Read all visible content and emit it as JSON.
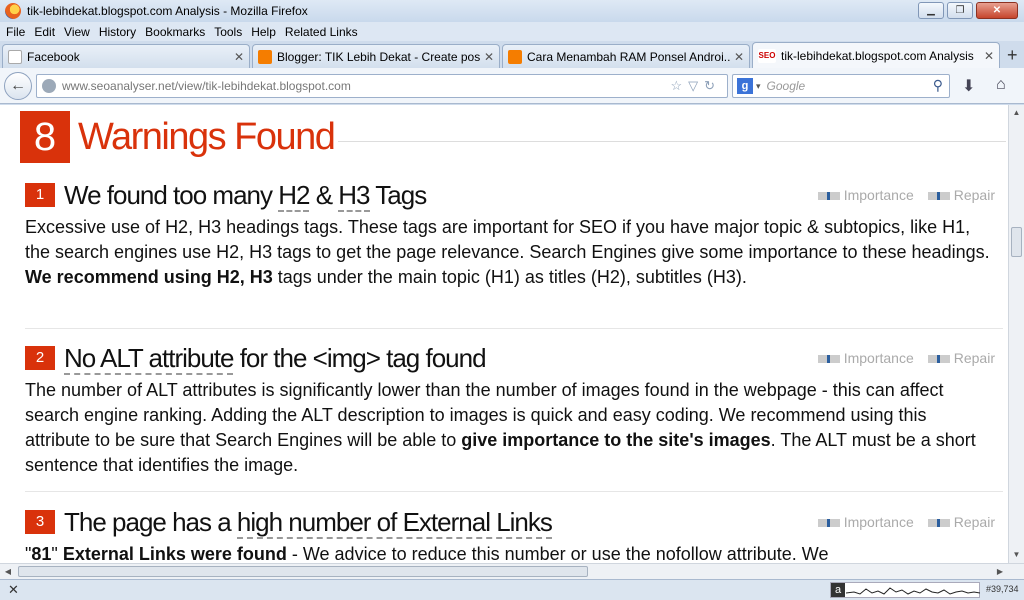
{
  "window": {
    "title": "tik-lebihdekat.blogspot.com Analysis - Mozilla Firefox"
  },
  "menu": [
    "File",
    "Edit",
    "View",
    "History",
    "Bookmarks",
    "Tools",
    "Help",
    "Related Links"
  ],
  "tabs": [
    {
      "label": "Facebook"
    },
    {
      "label": "Blogger: TIK Lebih Dekat - Create post"
    },
    {
      "label": "Cara Menambah RAM Ponsel Androi..."
    },
    {
      "label": "tik-lebihdekat.blogspot.com Analysis"
    }
  ],
  "nav": {
    "url_host": "www.seoanalyser.net",
    "url_path": "/view/tik-lebihdekat.blogspot.com",
    "search_engine": "g",
    "search_placeholder": "Google"
  },
  "warnings": {
    "count": "8",
    "title": "Warnings Found",
    "importance_label": "Importance",
    "repair_label": "Repair",
    "items": [
      {
        "num": "1",
        "title_pre": "We found too many ",
        "title_h2": "H2",
        "title_amp": " & ",
        "title_h3": "H3",
        "title_post": " Tags",
        "body": "Excessive use of H2, H3 headings tags. These tags are important for SEO if you have major topic & subtopics, like H1, the search engines use H2, H3 tags to get the page relevance. Search Engines give some importance to these headings. ",
        "body_bold": "We recommend using H2, H3",
        "body_tail": " tags under the main topic (H1) as titles (H2), subtitles (H3)."
      },
      {
        "num": "2",
        "title_link": "No ALT attribute",
        "title_post": " for the <img> tag found",
        "body": "The number of ALT attributes is significantly lower than the number of images found in the webpage - this can affect search engine ranking. Adding the ALT description to images is quick and easy coding. We recommend using this attribute to be sure that Search Engines will be able to ",
        "body_bold": "give importance to the site's images",
        "body_tail": ". The ALT must be a short sentence that identifies the image."
      },
      {
        "num": "3",
        "title_pre": "The page has a ",
        "title_link": "high number of External Links",
        "body_quote": "\"",
        "body_count": "81",
        "body_bold": " External Links were found",
        "body_tail": " - We advice to reduce this number or use the nofollow attribute. We"
      }
    ]
  },
  "status": {
    "rank": "#39,734"
  }
}
